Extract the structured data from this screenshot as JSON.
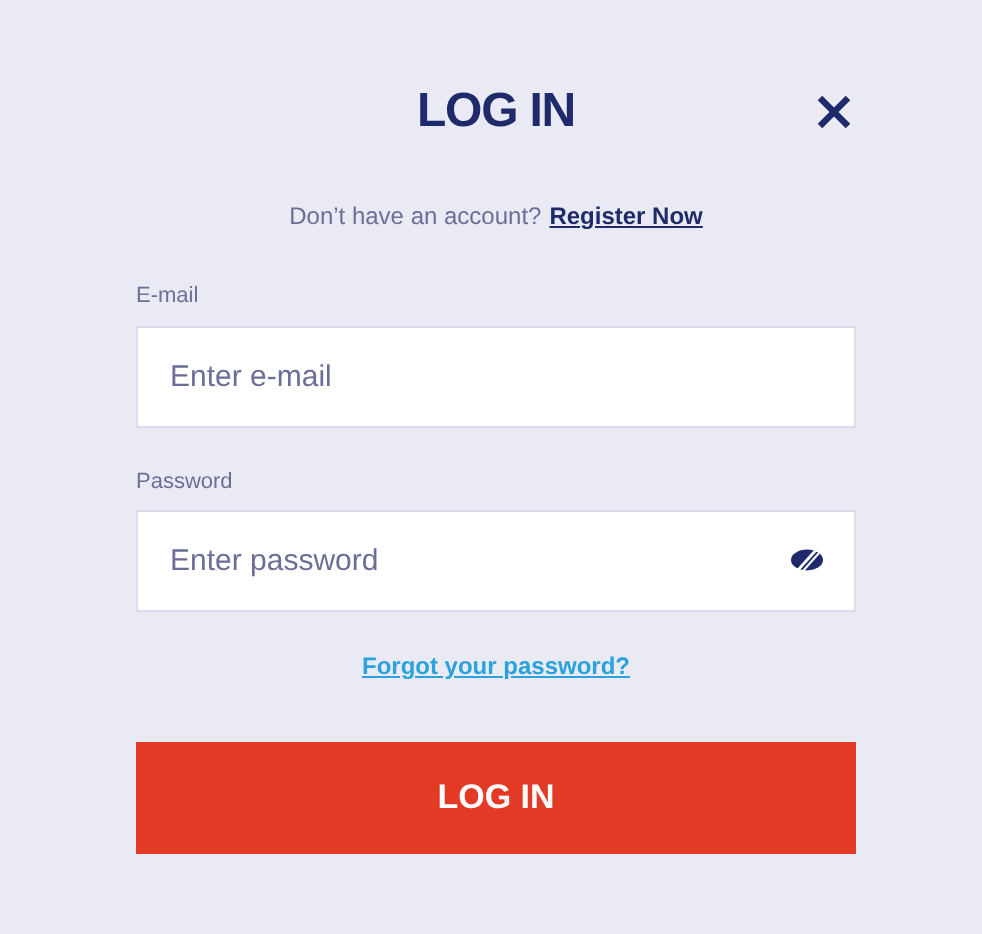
{
  "title": "LOG IN",
  "prompt": {
    "text": "Don’t have an account?",
    "link": "Register Now"
  },
  "fields": [
    {
      "label": "E-mail",
      "placeholder": "Enter e-mail",
      "kind": "text"
    },
    {
      "label": "Password",
      "placeholder": "Enter password",
      "kind": "password"
    }
  ],
  "forgot_link": "Forgot your password?",
  "submit": "LOG IN"
}
